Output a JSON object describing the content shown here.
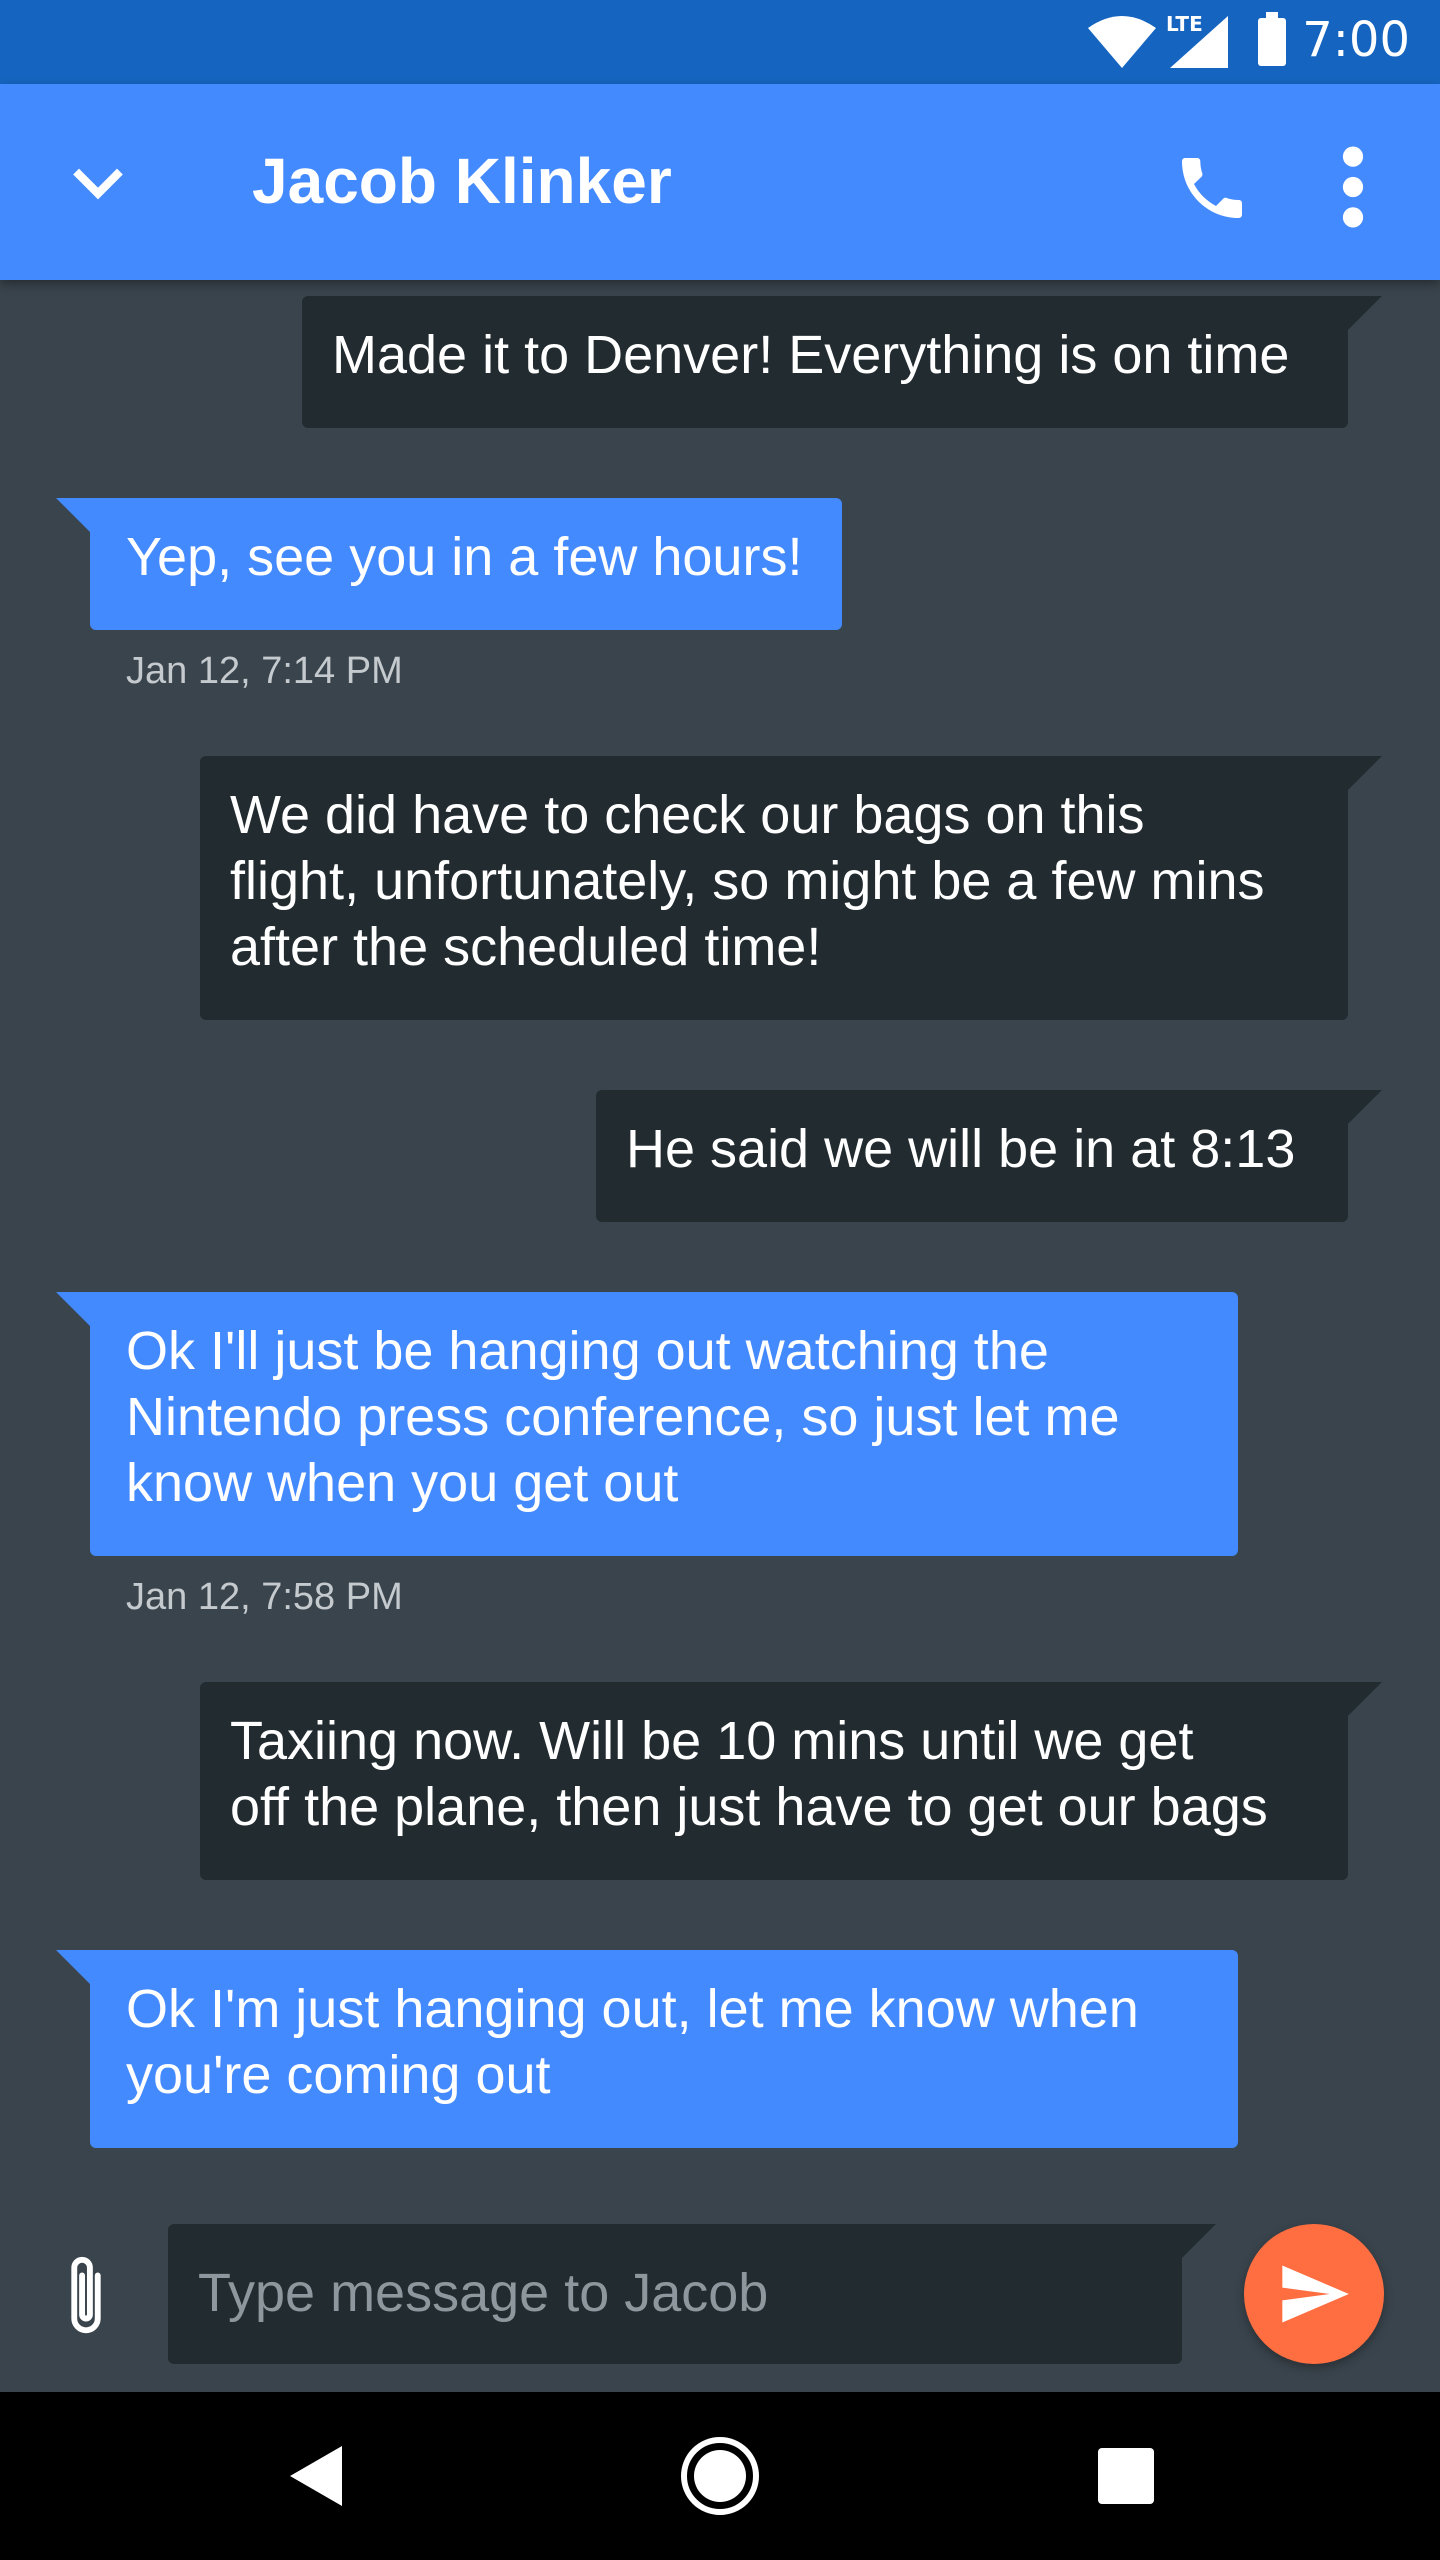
{
  "status_bar": {
    "time": "7:00",
    "network_label": "LTE"
  },
  "toolbar": {
    "title": "Jacob Klinker",
    "back_icon": "chevron-down-icon",
    "call_icon": "phone-icon",
    "more_icon": "more-vert-icon"
  },
  "messages": [
    {
      "direction": "sent",
      "text": "Made it to Denver! Everything is on time"
    },
    {
      "direction": "received",
      "text": "Yep, see you in a few hours!",
      "timestamp": "Jan 12, 7:14 PM"
    },
    {
      "direction": "sent",
      "lines": [
        "We did have to check our bags on this",
        "flight, unfortunately, so might be a few mins",
        "after the scheduled time!"
      ]
    },
    {
      "direction": "sent",
      "text": "He said we will be in at 8:13"
    },
    {
      "direction": "received",
      "lines": [
        "Ok I'll just be hanging out watching the",
        "Nintendo press conference, so just let me",
        "know when you get out"
      ],
      "timestamp": "Jan 12, 7:58 PM"
    },
    {
      "direction": "sent",
      "lines": [
        "Taxiing now. Will be 10 mins until we get",
        "off the plane, then just have to get our bags"
      ]
    },
    {
      "direction": "received",
      "lines": [
        "Ok I'm just hanging out, let me know when",
        "you're coming out"
      ]
    }
  ],
  "composer": {
    "placeholder": "Type message to Jacob",
    "attach_icon": "paperclip-icon",
    "send_icon": "send-icon"
  },
  "colors": {
    "status_bar": "#1565c0",
    "toolbar": "#448aff",
    "background": "#3a444c",
    "sent_bubble": "#222b30",
    "received_bubble": "#448aff",
    "send_button": "#ff6e40"
  }
}
